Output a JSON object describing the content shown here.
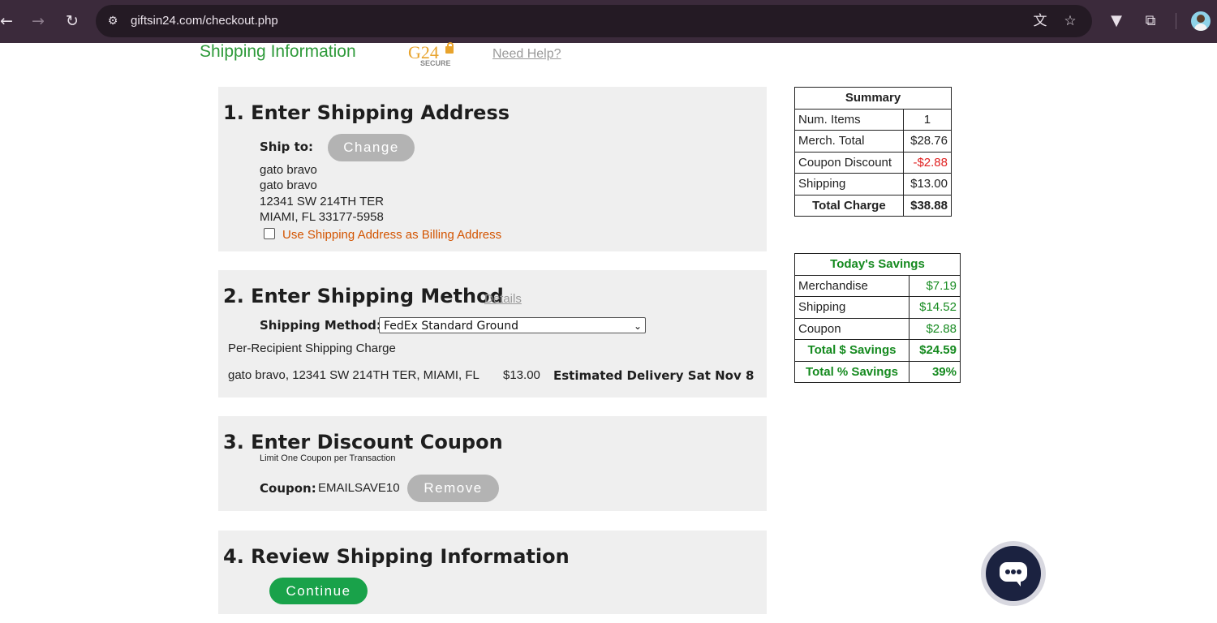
{
  "browser": {
    "url": "giftsin24.com/checkout.php"
  },
  "header": {
    "title": "Shipping Information",
    "secure_badge": {
      "brand": "G24",
      "text": "SECURE"
    },
    "need_help": "Need Help?"
  },
  "section1": {
    "title": "1. Enter Shipping Address",
    "ship_to_label": "Ship to:",
    "change_button": "Change",
    "address_lines": [
      "gato bravo",
      "gato bravo",
      "12341 SW 214TH TER",
      "MIAMI, FL 33177-5958"
    ],
    "billing_checkbox_label": "Use Shipping Address as Billing Address",
    "billing_checked": false
  },
  "section2": {
    "title": "2. Enter Shipping Method",
    "details_link": "Details",
    "method_label": "Shipping Method:",
    "method_selected": "FedEx Standard Ground",
    "per_recipient_label": "Per-Recipient Shipping Charge",
    "recipient": "gato bravo, 12341 SW 214TH TER, MIAMI, FL",
    "recipient_charge": "$13.00",
    "estimated_delivery": "Estimated Delivery Sat Nov 8"
  },
  "section3": {
    "title": "3. Enter Discount Coupon",
    "limit_note": "Limit One Coupon per Transaction",
    "coupon_label": "Coupon:",
    "coupon_code": "EMAILSAVE10",
    "remove_button": "Remove"
  },
  "section4": {
    "title": "4. Review Shipping Information",
    "continue_button": "Continue"
  },
  "summary": {
    "heading": "Summary",
    "rows": [
      {
        "label": "Num. Items",
        "value": "1"
      },
      {
        "label": "Merch. Total",
        "value": "$28.76"
      },
      {
        "label": "Coupon Discount",
        "value": "-$2.88"
      },
      {
        "label": "Shipping",
        "value": "$13.00"
      },
      {
        "label": "Total Charge",
        "value": "$38.88"
      }
    ]
  },
  "savings": {
    "heading": "Today's Savings",
    "rows": [
      {
        "label": "Merchandise",
        "value": "$7.19"
      },
      {
        "label": "Shipping",
        "value": "$14.52"
      },
      {
        "label": "Coupon",
        "value": "$2.88"
      },
      {
        "label": "Total $ Savings",
        "value": "$24.59"
      },
      {
        "label": "Total % Savings",
        "value": "39%"
      }
    ]
  },
  "colors": {
    "title_green": "#2e9a3a",
    "savings_green": "#158a1f",
    "discount_red": "#e02020",
    "link_orange": "#d35400",
    "continue_green": "#19a24a",
    "chrome_bg": "#3b2a3b"
  },
  "icons": {
    "back": "back-arrow-icon",
    "forward": "forward-arrow-icon",
    "reload": "reload-icon",
    "site_info": "site-settings-icon",
    "translate": "translate-icon",
    "bookmark": "star-icon",
    "extension_a": "shield-extension-icon",
    "extensions": "puzzle-icon",
    "chat": "chat-icon"
  }
}
